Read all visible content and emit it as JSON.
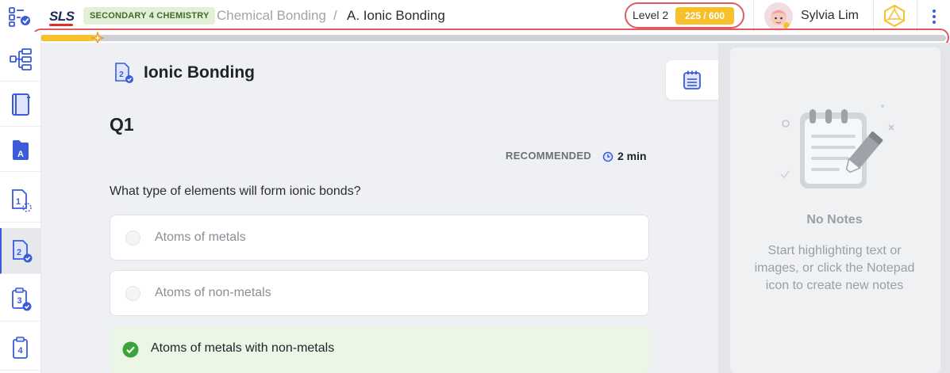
{
  "header": {
    "logo": "SLS",
    "subject_badge": "SECONDARY 4 CHEMISTRY",
    "breadcrumb": [
      "Chemical Bonding",
      "A. Ionic Bonding"
    ],
    "breadcrumb_separator": "/",
    "level_label": "Level 2",
    "xp_text": "225 / 600",
    "user_name": "Sylvia Lim"
  },
  "progress": {
    "value": 0.06
  },
  "sidebar": {
    "items": [
      {
        "icon": "lesson-map-icon"
      },
      {
        "icon": "tree-outline-icon"
      },
      {
        "icon": "notebook-icon"
      },
      {
        "icon": "section-a-icon",
        "label": "A"
      },
      {
        "icon": "step-1-icon",
        "label": "1"
      },
      {
        "icon": "step-2-icon",
        "label": "2",
        "active": true
      },
      {
        "icon": "step-3-icon",
        "label": "3"
      },
      {
        "icon": "step-4-icon",
        "label": "4"
      }
    ]
  },
  "lesson": {
    "step_number": "2",
    "title": "Ionic Bonding",
    "question_label": "Q1",
    "recommended_label": "RECOMMENDED",
    "duration": "2 min",
    "question_text": "What type of elements will form ionic bonds?",
    "options": [
      {
        "text": "Atoms of metals",
        "state": "unselected"
      },
      {
        "text": "Atoms of non-metals",
        "state": "unselected"
      },
      {
        "text": "Atoms of metals with non-metals",
        "state": "correct"
      }
    ]
  },
  "notes": {
    "empty_title": "No Notes",
    "empty_help": "Start highlighting text or images, or click the Notepad icon to create new notes"
  },
  "colors": {
    "accent": "#3b5bd9",
    "xp": "#f6c02a",
    "highlight_outline": "#e15a63",
    "correct_bg": "#ecf6e6",
    "correct_check": "#3aa43a"
  }
}
